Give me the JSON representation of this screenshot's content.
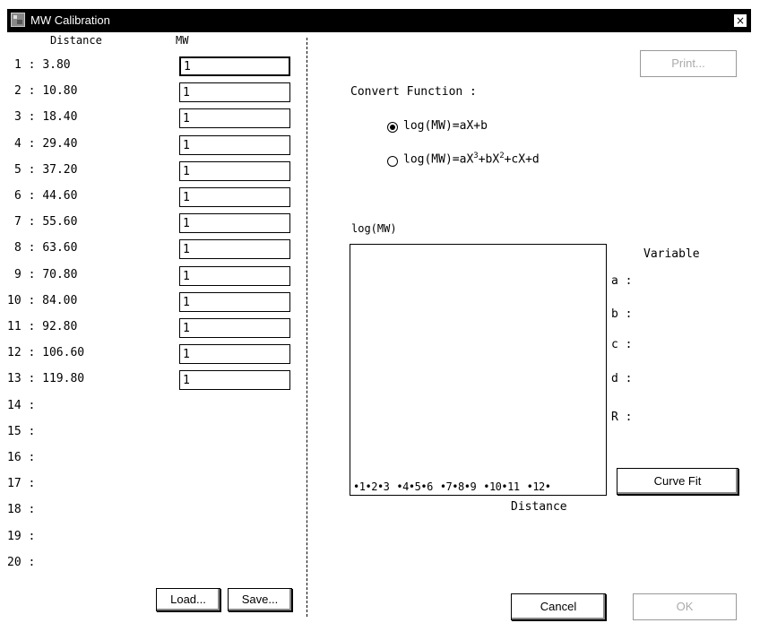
{
  "window": {
    "title": "MW Calibration",
    "close_glyph": "×",
    "app_icon": "app-icon"
  },
  "table": {
    "distance_header": "Distance",
    "mw_header": "MW",
    "rows": [
      {
        "index": "1",
        "distance": "3.80",
        "mw": "1"
      },
      {
        "index": "2",
        "distance": "10.80",
        "mw": "1"
      },
      {
        "index": "3",
        "distance": "18.40",
        "mw": "1"
      },
      {
        "index": "4",
        "distance": "29.40",
        "mw": "1"
      },
      {
        "index": "5",
        "distance": "37.20",
        "mw": "1"
      },
      {
        "index": "6",
        "distance": "44.60",
        "mw": "1"
      },
      {
        "index": "7",
        "distance": "55.60",
        "mw": "1"
      },
      {
        "index": "8",
        "distance": "63.60",
        "mw": "1"
      },
      {
        "index": "9",
        "distance": "70.80",
        "mw": "1"
      },
      {
        "index": "10",
        "distance": "84.00",
        "mw": "1"
      },
      {
        "index": "11",
        "distance": "92.80",
        "mw": "1"
      },
      {
        "index": "12",
        "distance": "106.60",
        "mw": "1"
      },
      {
        "index": "13",
        "distance": "119.80",
        "mw": "1"
      },
      {
        "index": "14",
        "distance": "",
        "mw": null
      },
      {
        "index": "15",
        "distance": "",
        "mw": null
      },
      {
        "index": "16",
        "distance": "",
        "mw": null
      },
      {
        "index": "17",
        "distance": "",
        "mw": null
      },
      {
        "index": "18",
        "distance": "",
        "mw": null
      },
      {
        "index": "19",
        "distance": "",
        "mw": null
      },
      {
        "index": "20",
        "distance": "",
        "mw": null
      }
    ]
  },
  "buttons": {
    "load": "Load...",
    "save": "Save...",
    "print": "Print...",
    "curve_fit": "Curve Fit",
    "cancel": "Cancel",
    "ok": "OK"
  },
  "convert": {
    "label": "Convert Function :",
    "linear_prefix": "log(MW)=aX+b",
    "cubic_part1": "log(MW)=aX",
    "cubic_sup1": "3",
    "cubic_part2": "+bX",
    "cubic_sup2": "2",
    "cubic_part3": "+cX+d",
    "selected": "linear"
  },
  "plot": {
    "y_label": "log(MW)",
    "x_label": "Distance",
    "markers": [
      "1",
      "2",
      "3",
      "4",
      "5",
      "6",
      "7",
      "8",
      "9",
      "10",
      "11",
      "12",
      ""
    ]
  },
  "variables": {
    "title": "Variable",
    "a": "a :",
    "b": "b :",
    "c": "c :",
    "d": "d :",
    "r": "R :"
  }
}
